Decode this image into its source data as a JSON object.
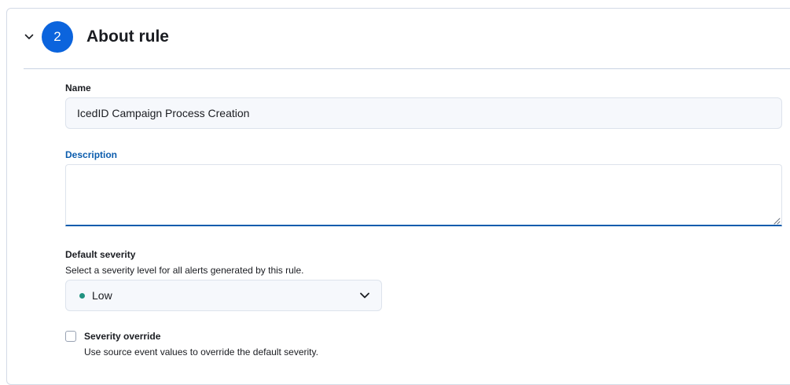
{
  "section": {
    "step_number": "2",
    "title": "About rule"
  },
  "name_field": {
    "label": "Name",
    "value": "IcedID Campaign Process Creation"
  },
  "description_field": {
    "label": "Description",
    "value": ""
  },
  "severity_field": {
    "label": "Default severity",
    "help_text": "Select a severity level for all alerts generated by this rule.",
    "selected_value": "Low",
    "indicator_color": "#209280"
  },
  "severity_override": {
    "label": "Severity override",
    "help_text": "Use source event values to override the default severity.",
    "checked": false
  },
  "colors": {
    "accent": "#0b64dd",
    "focus": "#0b5cad"
  }
}
